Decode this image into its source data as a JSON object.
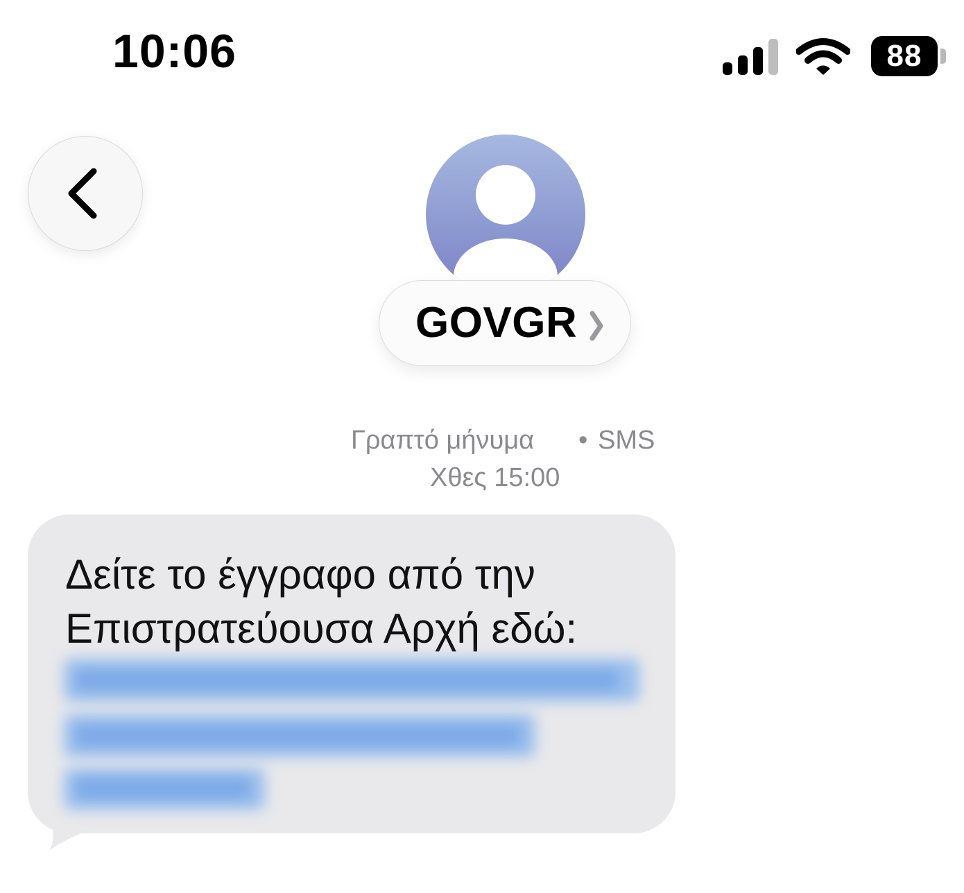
{
  "status_bar": {
    "time": "10:06",
    "battery_level": "88",
    "signal_icon": "cellular-signal-icon",
    "wifi_icon": "wifi-icon",
    "battery_icon": "battery-icon"
  },
  "header": {
    "back_icon": "chevron-left-icon",
    "avatar_icon": "person-avatar-icon",
    "contact_name": "GOVGR",
    "contact_chevron_icon": "chevron-right-icon"
  },
  "conversation": {
    "message_type": "Γραπτό μήνυμα",
    "separator": "•",
    "protocol": "SMS",
    "timestamp": "Χθες 15:00"
  },
  "message": {
    "line1": "Δείτε το έγγραφο από την",
    "line2": "Επιστρατεύουσα Αρχή εδώ:",
    "link_obscured": true
  },
  "colors": {
    "bubble": "#e9e9eb",
    "meta_text": "#8a8a8e",
    "link": "#7fb0ee",
    "avatar_gradient_top": "#a6b8e0",
    "avatar_gradient_bottom": "#7c80c4"
  }
}
